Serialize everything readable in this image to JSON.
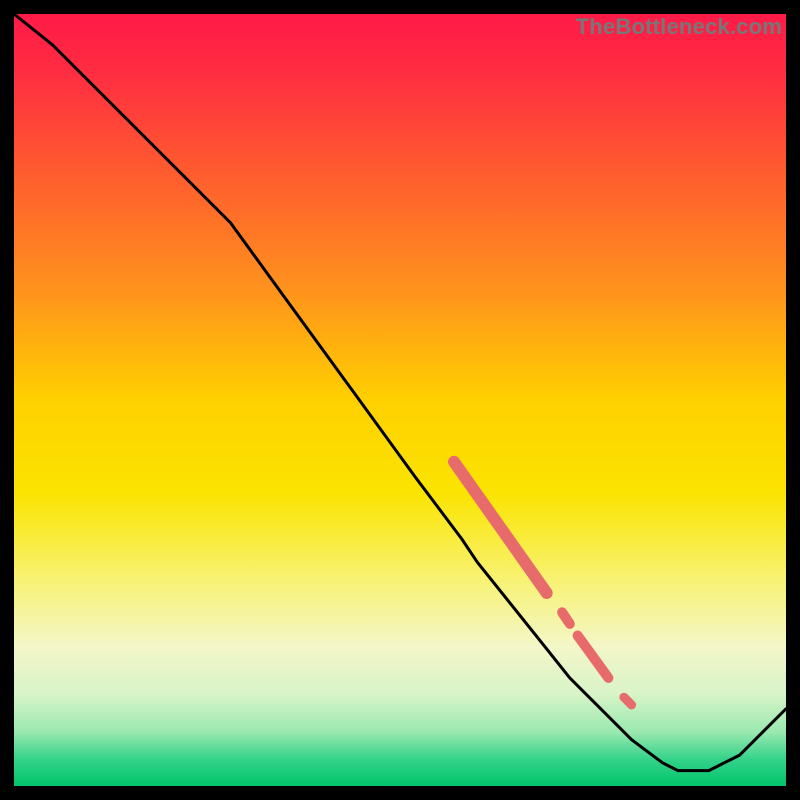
{
  "watermark": "TheBottleneck.com",
  "chart_data": {
    "type": "line",
    "title": "",
    "xlabel": "",
    "ylabel": "",
    "xlim": [
      0,
      100
    ],
    "ylim": [
      0,
      100
    ],
    "background_gradient": {
      "stops": [
        {
          "pos": 0.0,
          "color": "#ff1a47"
        },
        {
          "pos": 0.08,
          "color": "#ff2e41"
        },
        {
          "pos": 0.2,
          "color": "#ff5a2f"
        },
        {
          "pos": 0.35,
          "color": "#ff8f1e"
        },
        {
          "pos": 0.5,
          "color": "#ffd000"
        },
        {
          "pos": 0.62,
          "color": "#fbe400"
        },
        {
          "pos": 0.74,
          "color": "#f7f37a"
        },
        {
          "pos": 0.82,
          "color": "#f3f6c8"
        },
        {
          "pos": 0.88,
          "color": "#d8f4c8"
        },
        {
          "pos": 0.93,
          "color": "#9ae8b0"
        },
        {
          "pos": 0.965,
          "color": "#35d38a"
        },
        {
          "pos": 1.0,
          "color": "#00c46a"
        }
      ]
    },
    "series": [
      {
        "name": "bottleneck-curve",
        "x": [
          0,
          5,
          14,
          22,
          28,
          36,
          44,
          52,
          58,
          60,
          64,
          68,
          72,
          76,
          80,
          84,
          86,
          90,
          94,
          100
        ],
        "y": [
          100,
          96,
          87,
          79,
          73,
          62,
          51,
          40,
          32,
          29,
          24,
          19,
          14,
          10,
          6,
          3,
          2,
          2,
          4,
          10
        ]
      }
    ],
    "highlighted_segments": [
      {
        "name": "marker-cluster-upper",
        "x_start": 57,
        "y_start": 42,
        "x_end": 69,
        "y_end": 25,
        "color": "#e76b6b",
        "width": 12
      },
      {
        "name": "marker-dot-mid",
        "x_start": 71,
        "y_start": 22.5,
        "x_end": 72,
        "y_end": 21,
        "color": "#e76b6b",
        "width": 10
      },
      {
        "name": "marker-cluster-lower",
        "x_start": 73,
        "y_start": 19.5,
        "x_end": 77,
        "y_end": 14,
        "color": "#e76b6b",
        "width": 10
      },
      {
        "name": "marker-dot-bottom",
        "x_start": 79,
        "y_start": 11.5,
        "x_end": 80,
        "y_end": 10.5,
        "color": "#e76b6b",
        "width": 9
      }
    ]
  }
}
